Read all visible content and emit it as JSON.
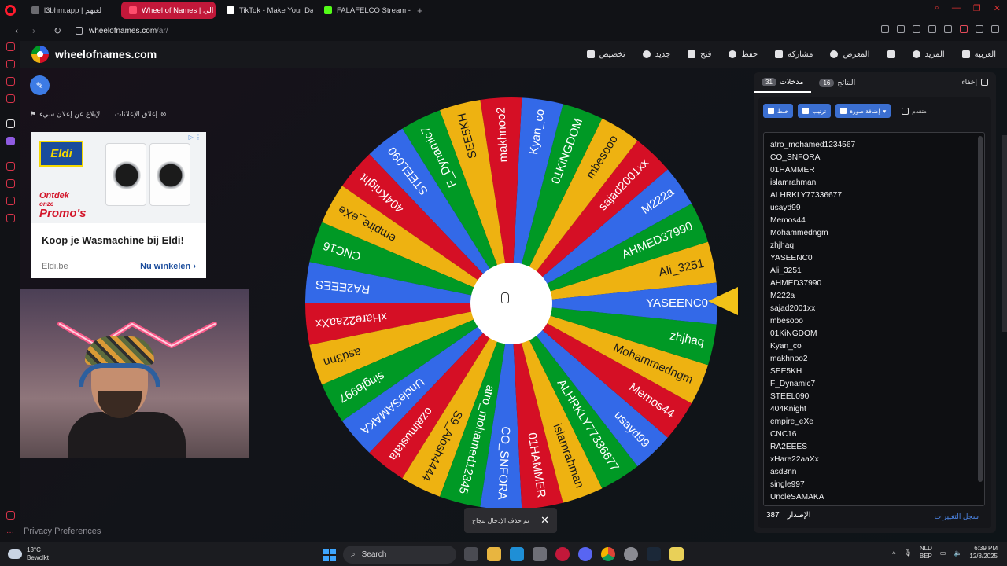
{
  "browser": {
    "tabs": [
      {
        "label": "l3bhm.app | لعبهم",
        "color": "#6b6b70"
      },
      {
        "label": "Wheel of Names | الي",
        "color": "#ff4d6d",
        "active": true
      },
      {
        "label": "TikTok - Make Your Day",
        "color": "#ffffff"
      },
      {
        "label": "FALAFELCO Stream - Wa",
        "color": "#53fc18"
      }
    ],
    "url_host": "wheelofnames.com",
    "url_path": "/ar/"
  },
  "app": {
    "site_name": "wheelofnames.com",
    "menu": [
      {
        "label": "تخصيص",
        "icon": "palette-icon"
      },
      {
        "label": "جديد",
        "icon": "new-file-icon"
      },
      {
        "label": "فتح",
        "icon": "folder-icon"
      },
      {
        "label": "حفظ",
        "icon": "save-icon"
      },
      {
        "label": "مشاركة",
        "icon": "share-icon"
      },
      {
        "label": "المعرض",
        "icon": "gallery-icon"
      },
      {
        "label": "",
        "icon": "fullscreen-icon"
      },
      {
        "label": "المزيد",
        "icon": "more-dropdown-icon"
      },
      {
        "label": "العربية",
        "icon": "globe-icon"
      }
    ]
  },
  "ads": {
    "close_label": "إغلاق الإعلانات",
    "report_label": "الإبلاغ عن إعلان سيء",
    "brand": "Eldi",
    "promo_line1": "Ontdek",
    "promo_line2": "onze",
    "promo_line3": "Promo's",
    "title": "Koop je Wasmachine bij Eldi!",
    "site": "Eldi.be",
    "cta": "Nu winkelen"
  },
  "privacy_label": "Privacy Preferences",
  "wheel": {
    "slice_colors": [
      "#eeb211",
      "#009925",
      "#3369e8",
      "#d50f25"
    ],
    "entries_on_wheel": [
      "Ali_3251",
      "AHMED37990",
      "M222a",
      "sajad2001xx",
      "mbesooo",
      "01KiNGDOM",
      "Kyan_co",
      "makhnoo2",
      "SEE5KH",
      "F_Dynamic7",
      "STEEL090",
      "404Knight",
      "empire_eXe",
      "CNC16",
      "RA2EEES",
      "xHare22aaXx",
      "asd3nn",
      "single997",
      "UncleSAMAKA",
      "ozalmustafa",
      "S9_Alosh4444",
      "atro_mohamed12345",
      "CO_SNFORA",
      "01HAMMER",
      "islamrahman",
      "ALHRKLY77336677",
      "usayd99",
      "Memos44",
      "Mohammedngm",
      "zhjhaq",
      "YASEENC0"
    ]
  },
  "toast": {
    "text": "تم حذف الإدخال بنجاح",
    "close": "✕"
  },
  "panel": {
    "tab_entries": "مدخلات",
    "entries_count": "31",
    "tab_results": "النتائج",
    "results_count": "16",
    "hide_label": "إخفاء",
    "shuffle_label": "خلط",
    "sort_label": "ترتيب",
    "add_image_label": "إضافة صورة",
    "advanced_label": "متقدم",
    "entries": [
      "atro_mohamed1234567",
      "CO_SNFORA",
      "01HAMMER",
      "islamrahman",
      "ALHRKLY77336677",
      "usayd99",
      "Memos44",
      "Mohammedngm",
      "zhjhaq",
      "YASEENC0",
      "Ali_3251",
      "AHMED37990",
      "M222a",
      "sajad2001xx",
      "mbesooo",
      "01KiNGDOM",
      "Kyan_co",
      "makhnoo2",
      "SEE5KH",
      "F_Dynamic7",
      "STEEL090",
      "404Knight",
      "empire_eXe",
      "CNC16",
      "RA2EEES",
      "xHare22aaXx",
      "asd3nn",
      "single997",
      "UncleSAMAKA"
    ],
    "version_label": "الإصدار",
    "version_number": "387",
    "changelog_label": "سجل التغييرات"
  },
  "taskbar": {
    "temp": "13°C",
    "weather": "Bewolkt",
    "search": "Search",
    "lang1": "NLD",
    "lang2": "BEP",
    "time": "6:39 PM",
    "date": "12/8/2025"
  }
}
